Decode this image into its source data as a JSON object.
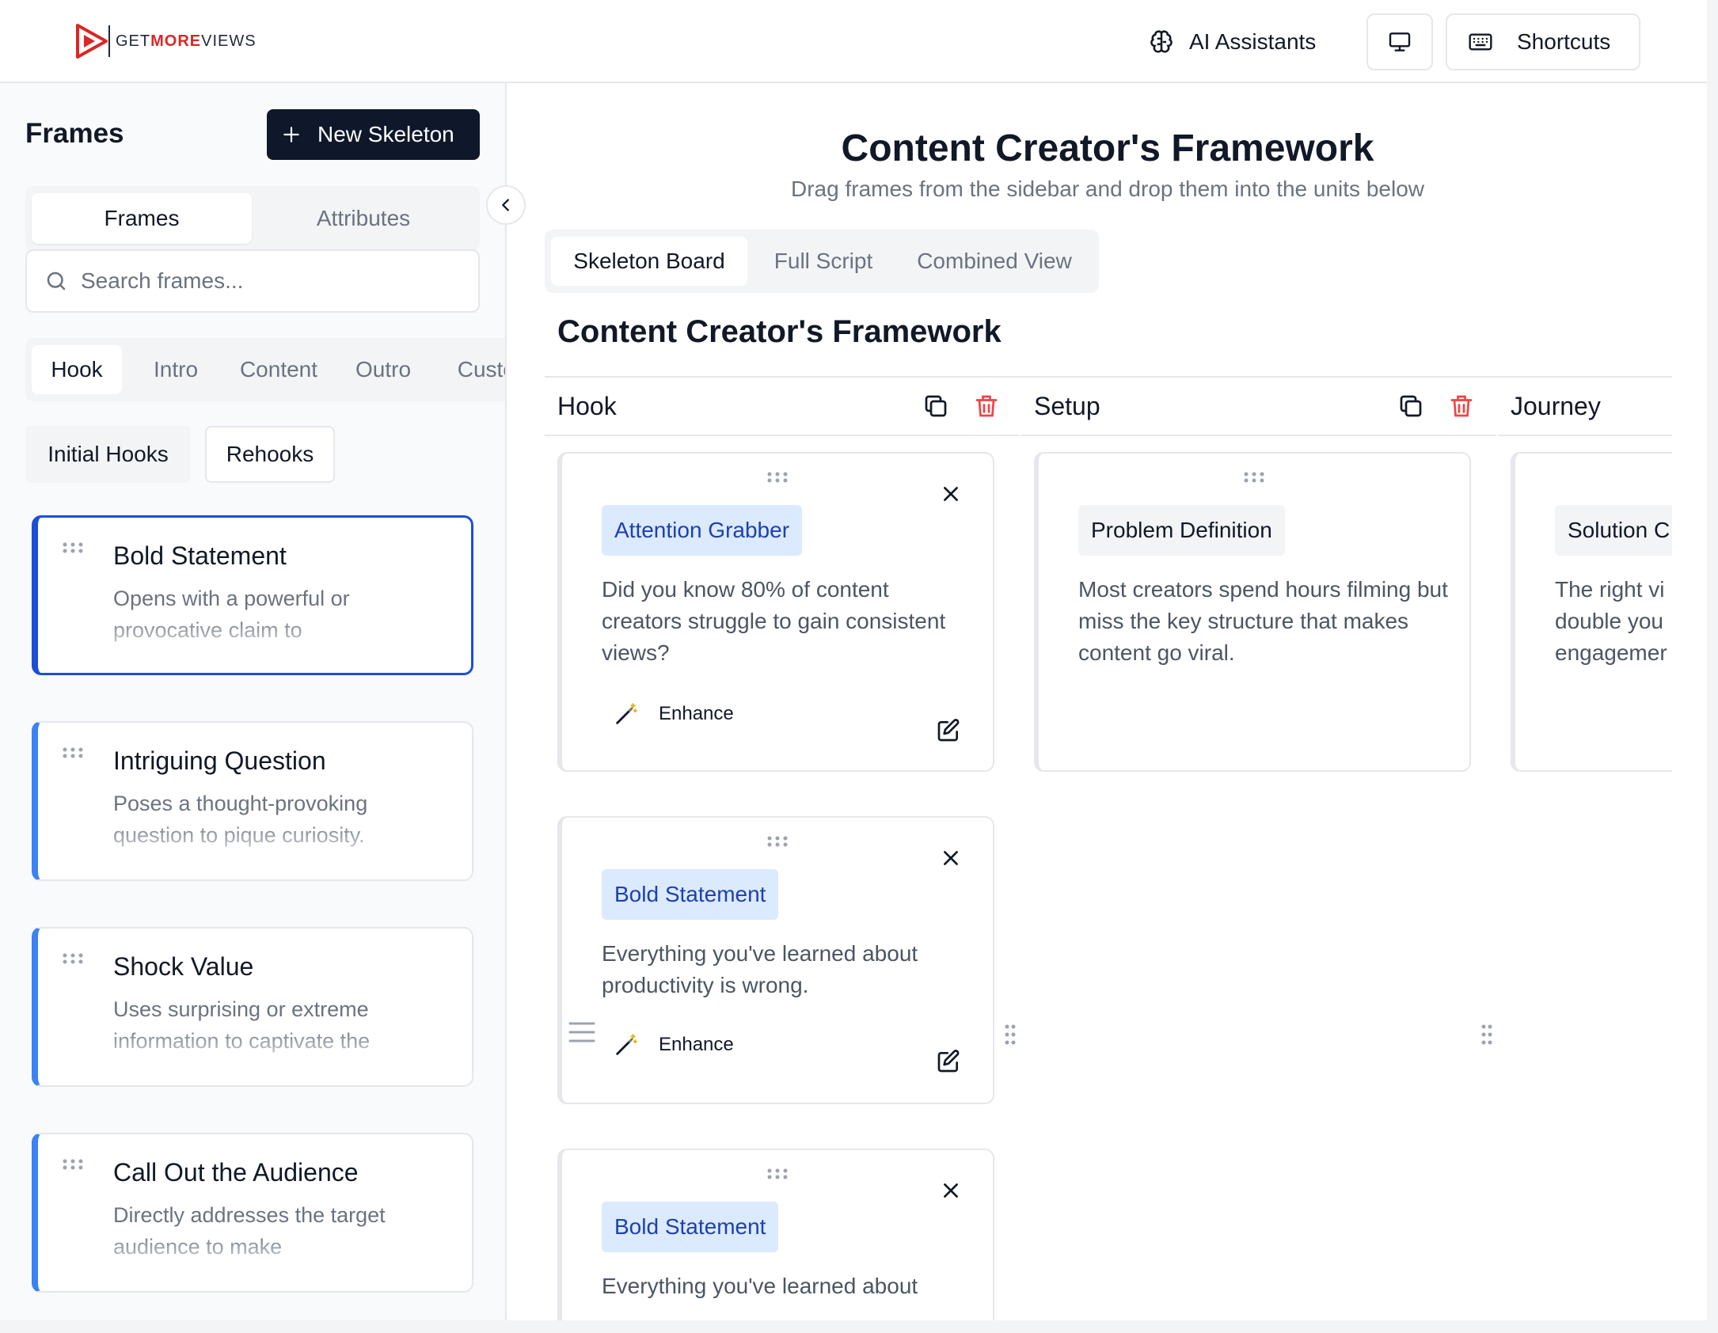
{
  "brand": {
    "logo_text_a": "GET",
    "logo_text_b": "MORE",
    "logo_text_c": "VIEWS",
    "accent": "#dc2626"
  },
  "topbar": {
    "ai_label": "AI Assistants",
    "shortcuts_label": "Shortcuts"
  },
  "sidebar": {
    "title": "Frames",
    "new_button": "New Skeleton",
    "tabs": [
      "Frames",
      "Attributes"
    ],
    "search_placeholder": "Search frames...",
    "categories": [
      "Hook",
      "Intro",
      "Content",
      "Outro",
      "Custom"
    ],
    "subcategories": [
      "Initial Hooks",
      "Rehooks"
    ],
    "frames": [
      {
        "title": "Bold Statement",
        "desc": "Opens with a powerful or provocative claim to"
      },
      {
        "title": "Intriguing Question",
        "desc": "Poses a thought-provoking question to pique curiosity."
      },
      {
        "title": "Shock Value",
        "desc": "Uses surprising or extreme information to captivate the"
      },
      {
        "title": "Call Out the Audience",
        "desc": "Directly addresses the target audience to make"
      }
    ]
  },
  "main": {
    "title": "Content Creator's Framework",
    "subtitle": "Drag frames from the sidebar and drop them into the units below",
    "view_tabs": [
      "Skeleton Board",
      "Full Script",
      "Combined View"
    ],
    "board_title": "Content Creator's Framework",
    "units": [
      {
        "name": "Hook"
      },
      {
        "name": "Setup"
      },
      {
        "name": "Journey"
      }
    ],
    "cards": {
      "hook_1": {
        "tag": "Attention Grabber",
        "body": "Did you know 80% of content creators struggle to gain consistent views?",
        "enhance": "Enhance"
      },
      "hook_2": {
        "tag": "Bold Statement",
        "body": "Everything you've learned about productivity is wrong.",
        "enhance": "Enhance"
      },
      "hook_3": {
        "tag": "Bold Statement",
        "body": "Everything you've learned about"
      },
      "setup_1": {
        "tag": "Problem Definition",
        "body": "Most creators spend hours filming but miss the key structure that makes content go viral."
      },
      "journey_1": {
        "tag": "Solution C",
        "body": "The right vi double you engagemer"
      }
    }
  }
}
